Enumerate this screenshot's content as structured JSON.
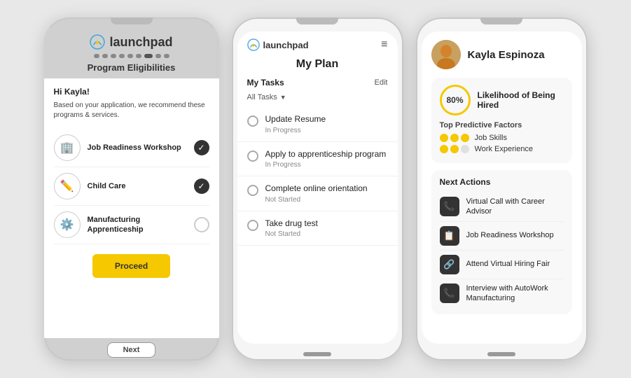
{
  "phone1": {
    "logo_text": "launchpad",
    "title": "Program Eligibilities",
    "greeting": "Hi Kayla!",
    "description": "Based on your application, we recommend these programs & services.",
    "programs": [
      {
        "name": "Job Readiness Workshop",
        "checked": true,
        "icon": "🏢"
      },
      {
        "name": "Child Care",
        "checked": true,
        "icon": "✏️"
      },
      {
        "name": "Manufacturing Apprenticeship",
        "checked": false,
        "icon": "⚙️"
      }
    ],
    "proceed_label": "Proceed",
    "next_label": "Next"
  },
  "phone2": {
    "logo_text": "launchpad",
    "title": "My Plan",
    "tasks_label": "My Tasks",
    "edit_label": "Edit",
    "filter_label": "All Tasks",
    "tasks": [
      {
        "name": "Update Resume",
        "status": "In Progress"
      },
      {
        "name": "Apply to apprenticeship program",
        "status": "In Progress"
      },
      {
        "name": "Complete online orientation",
        "status": "Not Started"
      },
      {
        "name": "Take drug test",
        "status": "Not Started"
      }
    ]
  },
  "phone3": {
    "user_name": "Kayla Espinoza",
    "likelihood_pct": "80%",
    "likelihood_label": "Likelihood of Being Hired",
    "predictive_title": "Top Predictive Factors",
    "factors": [
      {
        "label": "Job Skills",
        "filled": 3,
        "total": 3
      },
      {
        "label": "Work Experience",
        "filled": 2,
        "total": 3
      }
    ],
    "next_actions_title": "Next Actions",
    "actions": [
      {
        "label": "Virtual Call with Career Advisor",
        "icon": "📞"
      },
      {
        "label": "Job Readiness Workshop",
        "icon": "📋"
      },
      {
        "label": "Attend Virtual Hiring Fair",
        "icon": "🔗"
      },
      {
        "label": "Interview with AutoWork Manufacturing",
        "icon": "📞"
      }
    ]
  }
}
